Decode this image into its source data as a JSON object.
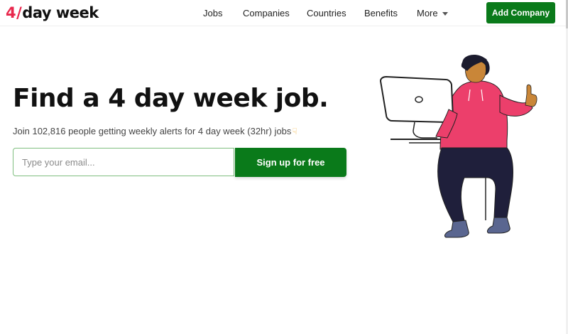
{
  "header": {
    "logo": {
      "num": "4",
      "slash": "/",
      "rest": "day week"
    },
    "nav": [
      {
        "label": "Jobs"
      },
      {
        "label": "Companies"
      },
      {
        "label": "Countries"
      },
      {
        "label": "Benefits"
      },
      {
        "label": "More"
      }
    ],
    "add_company_label": "Add Company"
  },
  "hero": {
    "title": "Find a 4 day week job.",
    "subtitle": "Join 102,816 people getting weekly alerts for 4 day week (32hr) jobs",
    "email_placeholder": "Type your email...",
    "signup_label": "Sign up for free"
  },
  "colors": {
    "brand_green": "#0a7a1a",
    "logo_pink": "#e8274c",
    "hoodie_pink": "#ec3f6b",
    "skin": "#c98638",
    "pants": "#1f1f3b"
  }
}
